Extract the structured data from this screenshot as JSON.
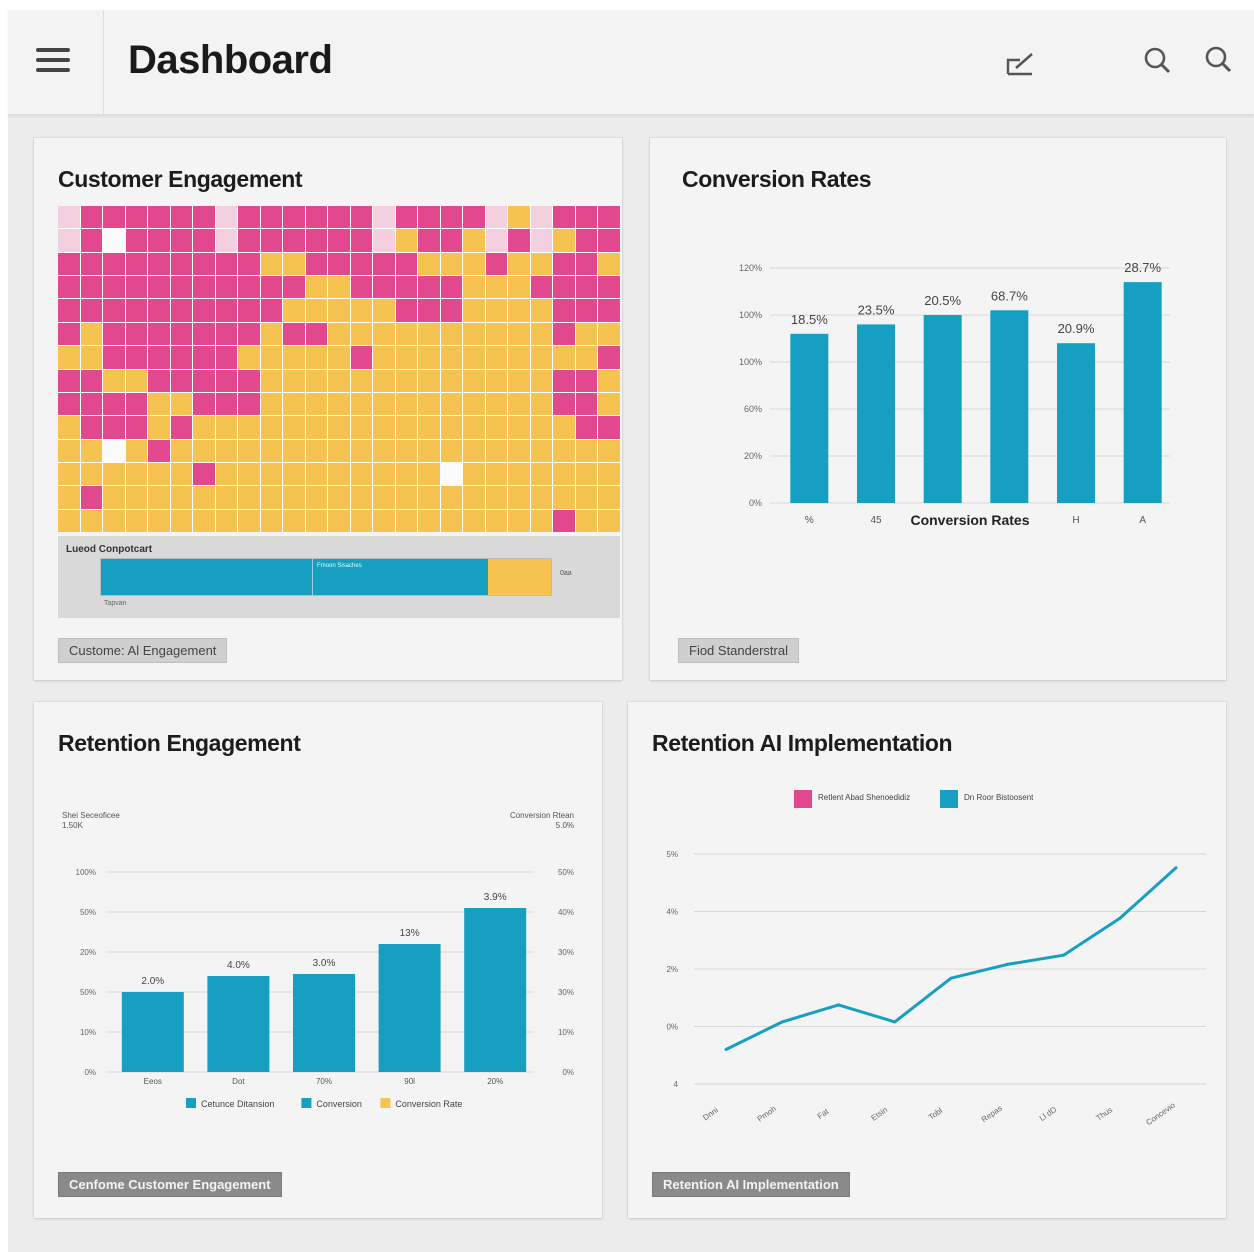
{
  "header": {
    "title": "Dashboard"
  },
  "cards": {
    "engagement": {
      "title": "Customer Engagement",
      "legend_label": "Lueod Conpotcart",
      "bar_segment_label": "Fmoon Sisaches",
      "bar_side_label": "0aa",
      "bar_under_label": "Tapvan",
      "tag": "Custome: Al Engagement",
      "colors": {
        "pink": "#e1488d",
        "yellow": "#f6c250",
        "light": "#f4cfe0",
        "white": "#fbfbfb",
        "teal": "#169fc1"
      }
    },
    "conversion": {
      "title": "Conversion Rates",
      "tag": "Fiod Standerstral"
    },
    "retention_engagement": {
      "title": "Retention Engagement",
      "tag": "Cenfome Customer Engagement"
    },
    "retention_ai": {
      "title": "Retention AI Implementation",
      "tag": "Retention AI Implementation"
    }
  },
  "chart_data": [
    {
      "type": "bar",
      "title": "Conversion Rates",
      "xlabel": "Conversion Rates",
      "categories": [
        "%",
        "45",
        "",
        "",
        "H",
        "A"
      ],
      "values": [
        72,
        76,
        80,
        82,
        68,
        94
      ],
      "data_labels": [
        "18.5%",
        "23.5%",
        "20.5%",
        "68.7%",
        "20.9%",
        "28.7%"
      ],
      "yticks": [
        "0%",
        "20%",
        "60%",
        "100%",
        "100%",
        "120%"
      ],
      "ylim": [
        0,
        100
      ],
      "color": "#169fc1",
      "grid": true
    },
    {
      "type": "bar",
      "title": "Retention Engagement",
      "left_axis_title": [
        "Shei Seceoficee",
        "1.50K"
      ],
      "right_axis_title": [
        "Conversion Rtean",
        "5.0%"
      ],
      "categories": [
        "Eeos",
        "Dot",
        "70%",
        "90l",
        "20%"
      ],
      "values": [
        2.0,
        2.4,
        2.45,
        3.2,
        4.1
      ],
      "data_labels": [
        "2.0%",
        "4.0%",
        "3.0%",
        "13%",
        "3.9%"
      ],
      "yticks_left": [
        "0%",
        "10%",
        "50%",
        "20%",
        "50%",
        "100%"
      ],
      "yticks_right": [
        "0%",
        "10%",
        "30%",
        "30%",
        "40%",
        "50%"
      ],
      "ylim": [
        0,
        5
      ],
      "color": "#169fc1",
      "legend": [
        {
          "name": "Cetunce Ditansion",
          "color": "#169fc1"
        },
        {
          "name": "Conversion",
          "color": "#169fc1"
        },
        {
          "name": "Conversion Rate",
          "color": "#f6c250"
        }
      ],
      "grid": true
    },
    {
      "type": "line",
      "title": "Retention AI Implementation",
      "categories": [
        "Dnni",
        "Pmoh",
        "Fat",
        "Etsin",
        "Tobl",
        "Repas",
        "Ll dD",
        "Thus",
        "Concevio"
      ],
      "values": [
        -0.25,
        0.35,
        0.72,
        0.35,
        1.3,
        1.6,
        1.8,
        2.6,
        3.7
      ],
      "yticks": [
        "4",
        "0%",
        "2%",
        "4%",
        "5%"
      ],
      "ylim": [
        -1,
        4
      ],
      "color": "#169fc1",
      "legend": [
        {
          "name": "Retlent Abad Shenoedidiz",
          "color": "#e1488d"
        },
        {
          "name": "Dn Roor Bistoosent",
          "color": "#169fc1"
        }
      ],
      "grid": true
    }
  ]
}
